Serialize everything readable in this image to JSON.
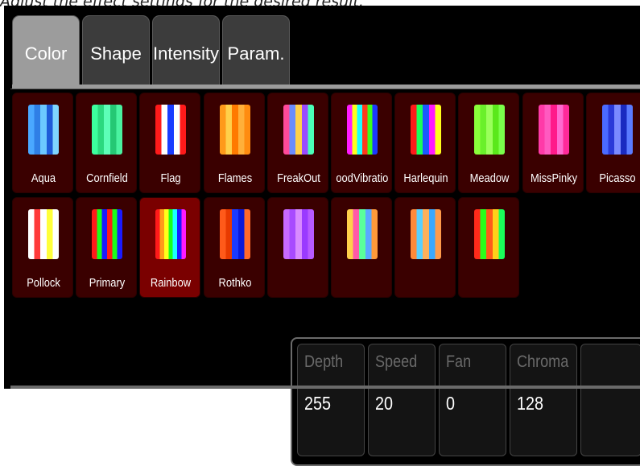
{
  "instruction": "Adjust the effect settings for the desired result.",
  "tabs": [
    {
      "label": "Color",
      "active": true
    },
    {
      "label": "Shape",
      "active": false
    },
    {
      "label": "Intensity",
      "active": false
    },
    {
      "label": "Param.",
      "active": false
    }
  ],
  "effects_row1": [
    {
      "label": "Aqua",
      "icon": "aqua-swatch-icon",
      "colors": [
        "#4aa8ff",
        "#2f7fe6",
        "#6cc8ff",
        "#1e5bd8",
        "#7fd6ff"
      ]
    },
    {
      "label": "Cornfield",
      "icon": "cornfield-swatch-icon",
      "colors": [
        "#3cff9e",
        "#2bd97f",
        "#5dffb8",
        "#25c874",
        "#4af2a0"
      ]
    },
    {
      "label": "Flag",
      "icon": "flag-swatch-icon",
      "colors": [
        "#ff1a1a",
        "#ffffff",
        "#1a3cff",
        "#ffffff",
        "#ff1a1a"
      ]
    },
    {
      "label": "Flames",
      "icon": "flames-swatch-icon",
      "colors": [
        "#ff9a1a",
        "#ffd04a",
        "#ff7a00",
        "#ffb03a",
        "#ff8c10"
      ]
    },
    {
      "label": "FreakOut",
      "icon": "freakout-swatch-icon",
      "colors": [
        "#ff4a9a",
        "#6a8cff",
        "#ffd04a",
        "#9a4aff",
        "#4affb8"
      ]
    },
    {
      "label": "oodVibratior",
      "icon": "goodvibrations-swatch-icon",
      "colors": [
        "#ff1aff",
        "#ffff1a",
        "#1affff",
        "#ff3a1a",
        "#3aff1a",
        "#1a3aff"
      ]
    },
    {
      "label": "Harlequin",
      "icon": "harlequin-swatch-icon",
      "colors": [
        "#ff1a1a",
        "#1aff5a",
        "#1a5aff",
        "#ff1aff",
        "#ffff1a"
      ]
    },
    {
      "label": "Meadow",
      "icon": "meadow-swatch-icon",
      "colors": [
        "#8aff3a",
        "#6af02a",
        "#9aff5a",
        "#5ae81a",
        "#7aff4a"
      ]
    },
    {
      "label": "MissPinky",
      "icon": "misspinky-swatch-icon",
      "colors": [
        "#ff3aa8",
        "#ff5ac0",
        "#ff1a8a",
        "#ff6ad0",
        "#ff2a9a"
      ]
    },
    {
      "label": "Picasso",
      "icon": "picasso-swatch-icon",
      "colors": [
        "#4a6aff",
        "#2a3ad8",
        "#7a8aff",
        "#1a2ac0",
        "#5a7aff"
      ]
    }
  ],
  "effects_row2": [
    {
      "label": "Pollock",
      "icon": "pollock-swatch-icon",
      "colors": [
        "#ffffff",
        "#ff3a3a",
        "#ffffff",
        "#ffff3a",
        "#ffffff"
      ]
    },
    {
      "label": "Primary",
      "icon": "primary-swatch-icon",
      "colors": [
        "#ff1a1a",
        "#1aff1a",
        "#1a1aff",
        "#ff1a1a",
        "#1aff1a",
        "#1a1aff"
      ]
    },
    {
      "label": "Rainbow",
      "icon": "rainbow-swatch-icon",
      "colors": [
        "#ff1a1a",
        "#ff9a1a",
        "#ffff1a",
        "#1aff1a",
        "#1affff",
        "#1a1aff",
        "#ff1aff"
      ]
    },
    {
      "label": "Rothko",
      "icon": "rothko-swatch-icon",
      "colors": [
        "#ff5a1a",
        "#e83a00",
        "#1a3aff",
        "#0a1ad8",
        "#ff6a2a"
      ]
    },
    {
      "label": "",
      "icon": "purple-swatch-icon",
      "colors": [
        "#c86aff",
        "#a84aff",
        "#d88aff",
        "#9a3aff",
        "#b85aff"
      ]
    },
    {
      "label": "",
      "icon": "multicolor-swatch-icon",
      "colors": [
        "#ffd04a",
        "#ff5aa8",
        "#5aff9a",
        "#5aa8ff",
        "#ff9a3a"
      ]
    },
    {
      "label": "",
      "icon": "orange-blue-swatch-icon",
      "colors": [
        "#ff8a3a",
        "#5ad0ff",
        "#ffb05a",
        "#3aa8ff",
        "#ff9a4a"
      ]
    },
    {
      "label": "",
      "icon": "red-green-swatch-icon",
      "colors": [
        "#ff2a1a",
        "#2aff1a",
        "#ff5a1a",
        "#ffd01a",
        "#1aff5a"
      ]
    }
  ],
  "selected_effect": "Rainbow",
  "params": [
    {
      "label": "Depth",
      "value": "255"
    },
    {
      "label": "Speed",
      "value": "20"
    },
    {
      "label": "Fan",
      "value": "0"
    },
    {
      "label": "Chroma",
      "value": "128"
    },
    {
      "label": "",
      "value": ""
    }
  ],
  "colors": {
    "panel_bg": "#000000",
    "tile_bg": "#3a0000",
    "tile_selected": "#7a0000",
    "active_tab": "#9c9c9c",
    "inactive_tab": "#3c3c3c",
    "param_label": "#6a6a6a"
  }
}
